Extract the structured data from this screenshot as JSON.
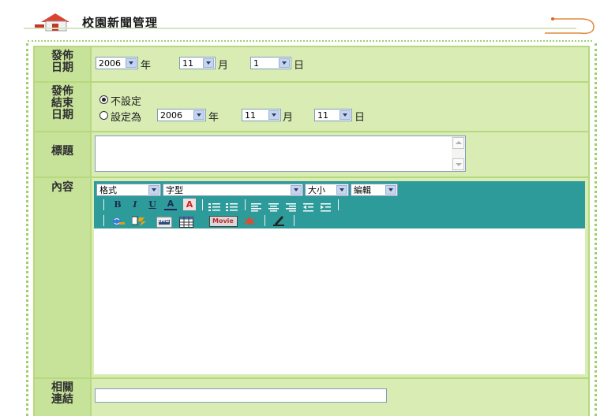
{
  "header": {
    "title": "校園新聞管理"
  },
  "colors": {
    "label_bg": "#c7e39a",
    "field_bg": "#d8ecb3",
    "toolbar_bg": "#2e9b9b",
    "border": "#9fcf6c"
  },
  "form": {
    "publish_date": {
      "label_line1": "發佈",
      "label_line2": "日期",
      "year": "2006",
      "year_unit": "年",
      "month": "11",
      "month_unit": "月",
      "day": "1",
      "day_unit": "日"
    },
    "end_date": {
      "label_line1": "發佈",
      "label_line2": "結束",
      "label_line3": "日期",
      "option_none": "不設定",
      "option_set": "設定為",
      "year": "2006",
      "year_unit": "年",
      "month": "11",
      "month_unit": "月",
      "day": "11",
      "day_unit": "日"
    },
    "title_field": {
      "label": "標題",
      "value": ""
    },
    "content": {
      "label": "內容",
      "toolbar": {
        "format_select": "格式",
        "font_select": "字型",
        "size_select": "大小",
        "edit_select": "編輯",
        "buttons_row1": [
          "B",
          "I",
          "U",
          "A",
          "A"
        ],
        "buttons_row2_labels": [
          "IMG",
          "Movie"
        ]
      }
    },
    "related_link": {
      "label_line1": "相關",
      "label_line2": "連結",
      "value": ""
    }
  }
}
